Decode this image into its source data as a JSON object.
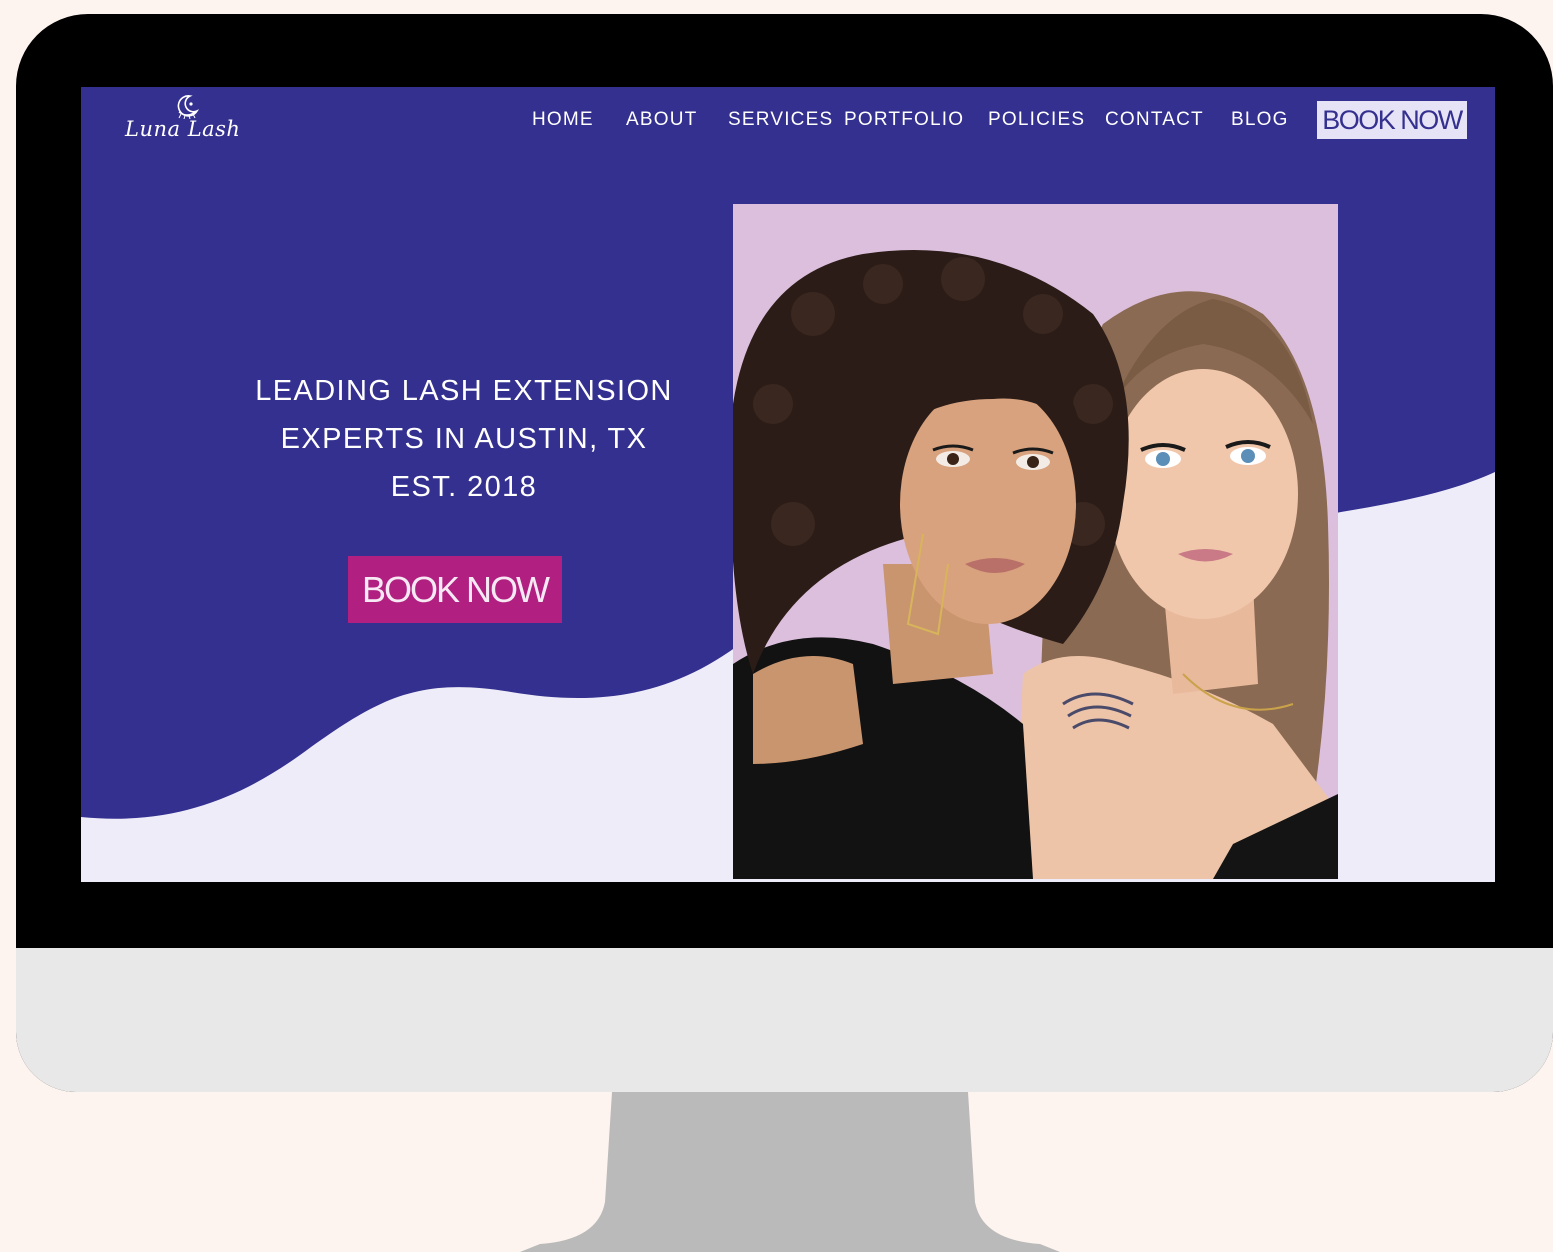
{
  "brand": {
    "name": "Luna Lash",
    "logo_icon": "moon-lash-icon"
  },
  "nav": {
    "items": [
      {
        "label": "HOME"
      },
      {
        "label": "ABOUT"
      },
      {
        "label": "SERVICES"
      },
      {
        "label": "PORTFOLIO"
      },
      {
        "label": "POLICIES"
      },
      {
        "label": "CONTACT"
      },
      {
        "label": "BLOG"
      }
    ],
    "cta_label": "BOOK NOW"
  },
  "hero": {
    "headline_line1": "LEADING LASH EXTENSION",
    "headline_line2": "EXPERTS IN AUSTIN, TX",
    "headline_line3": "EST. 2018",
    "cta_label": "BOOK NOW",
    "photo_alt": "two-women-portrait"
  },
  "colors": {
    "brand_indigo": "#34308f",
    "lavender_bg": "#eeecf8",
    "cta_magenta": "#b11f81",
    "page_bg": "#fdf4ef",
    "monitor_bezel": "#000000",
    "monitor_chin": "#e8e8e8",
    "monitor_stand": "#bababa"
  }
}
